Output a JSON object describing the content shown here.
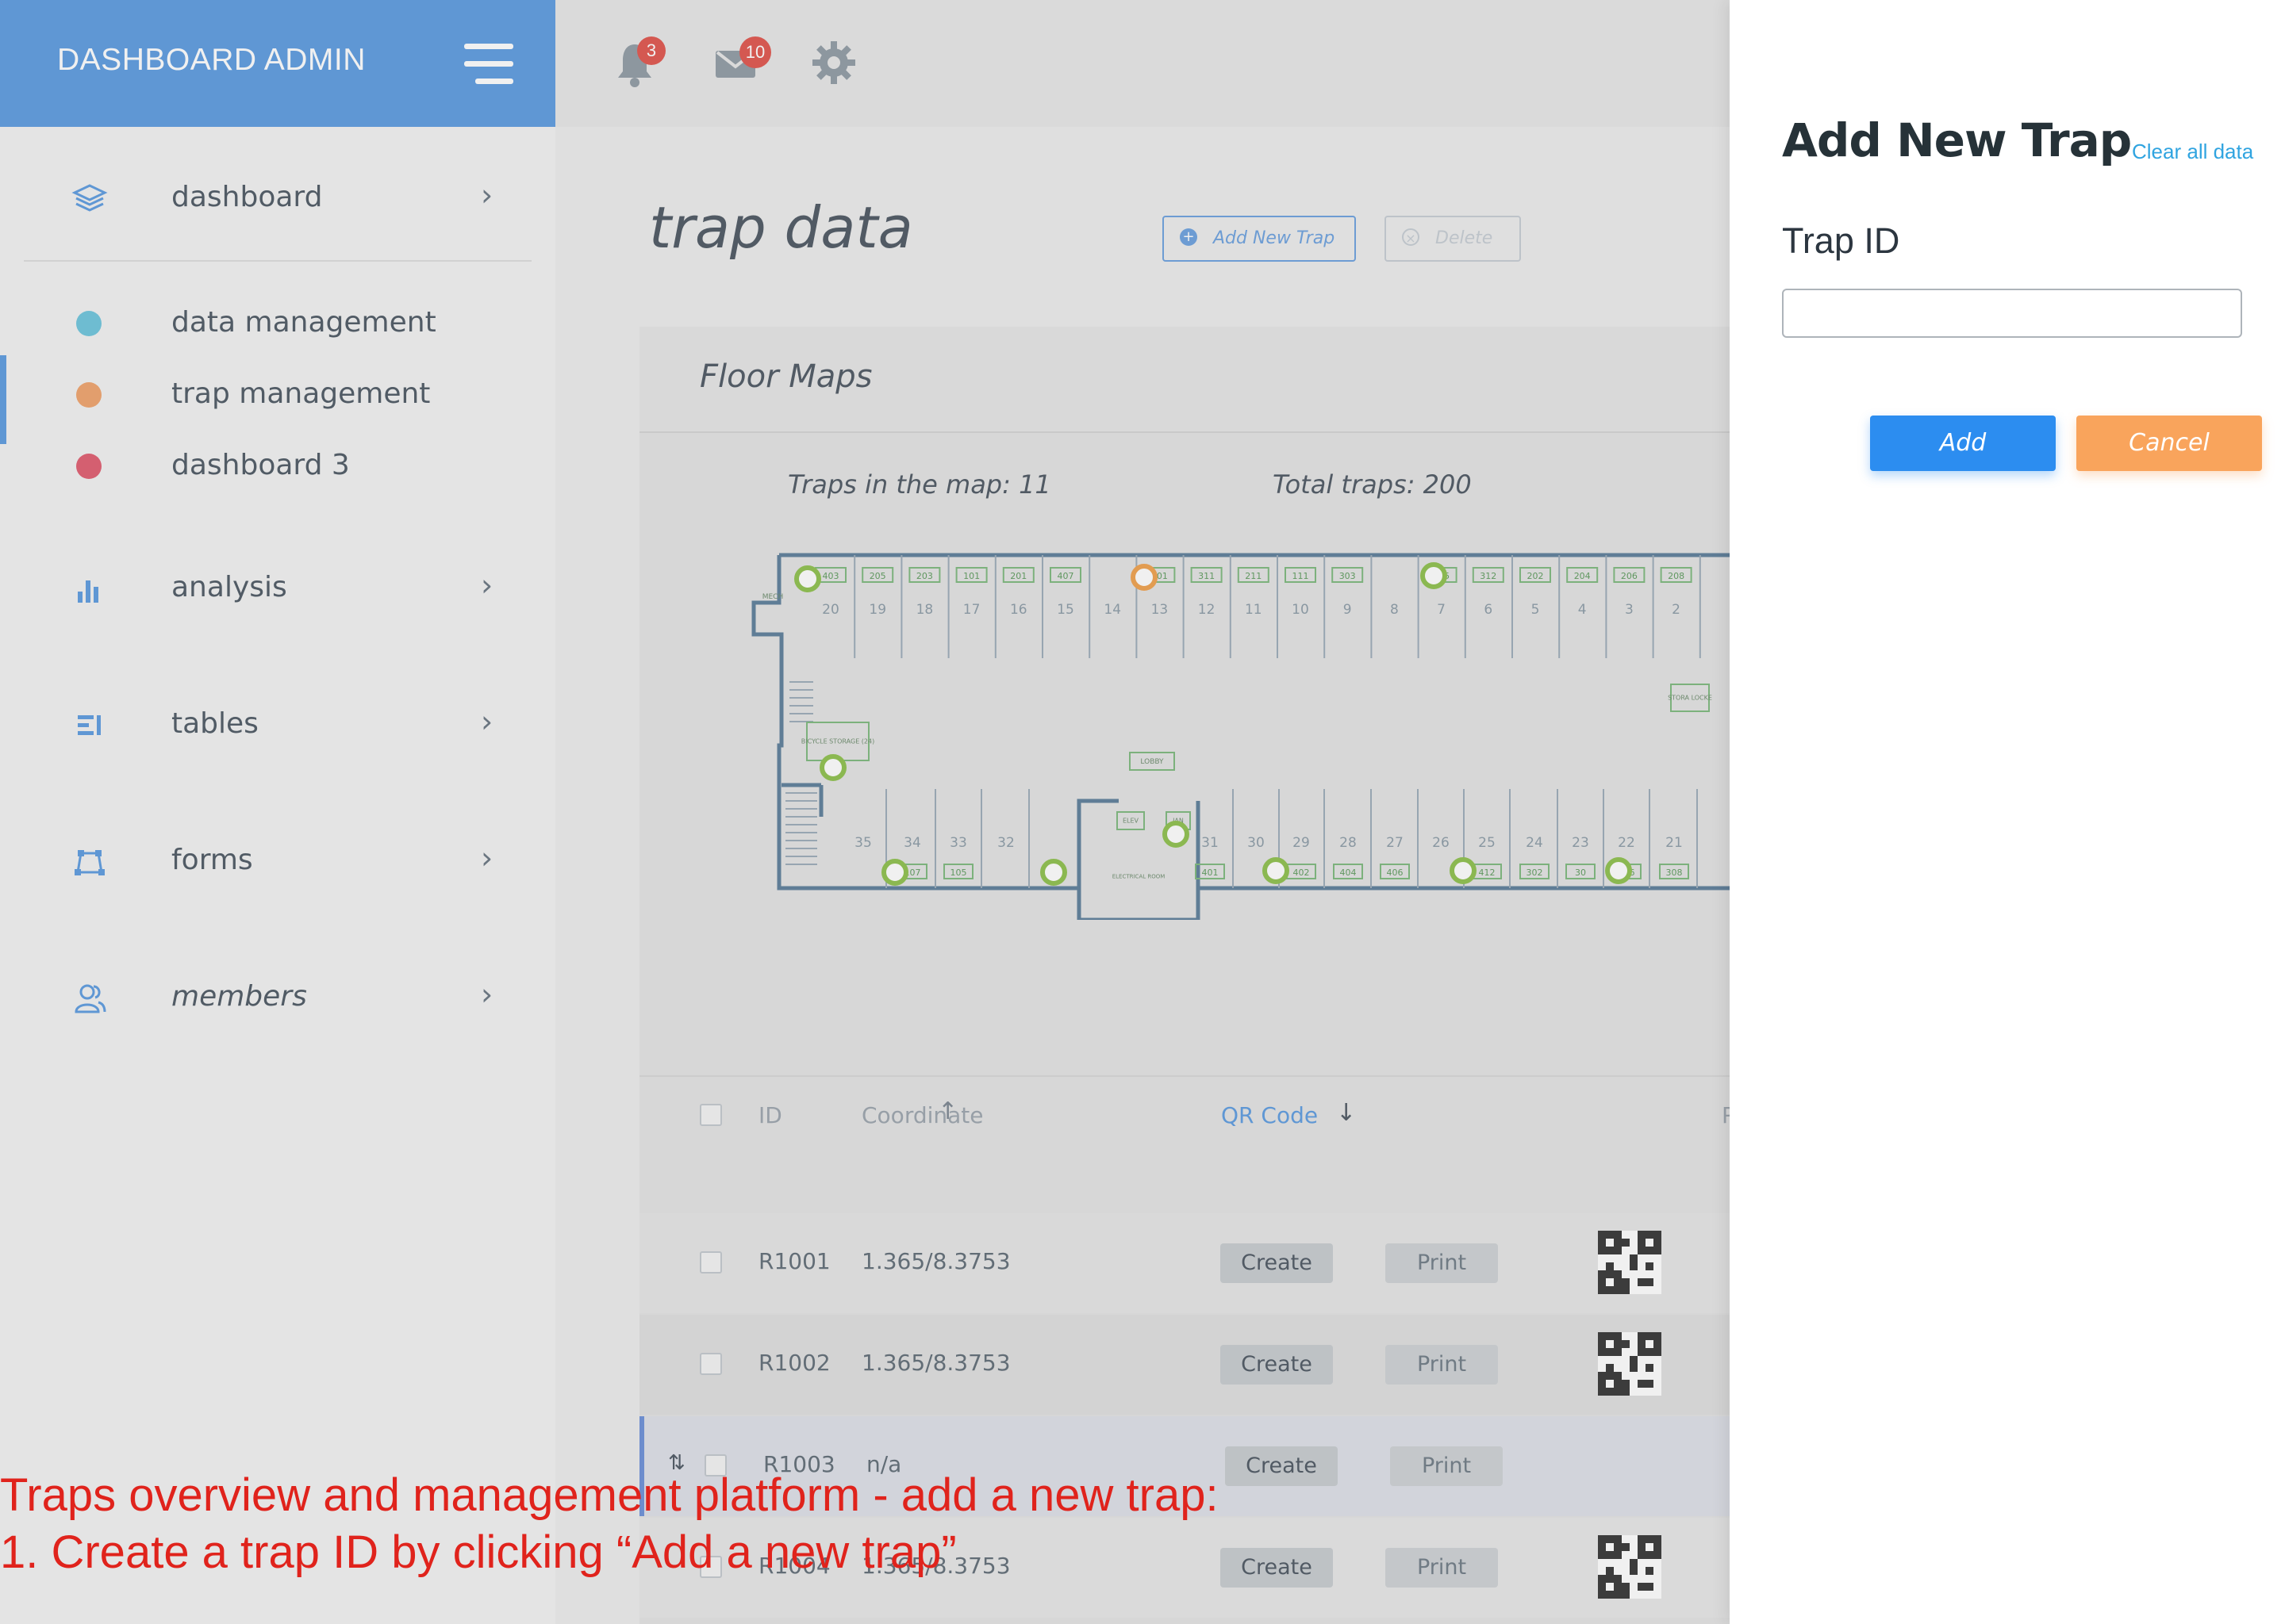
{
  "sidebar": {
    "brand": "DASHBOARD ADMIN",
    "items": [
      {
        "label": "dashboard",
        "icon": "layers-icon"
      },
      {
        "label": "data management",
        "dot_color": "#6cc4dc"
      },
      {
        "label": "trap management",
        "dot_color": "#f0a26a"
      },
      {
        "label": "dashboard 3",
        "dot_color": "#e05a6e"
      },
      {
        "label": "analysis",
        "icon": "bar-chart-icon"
      },
      {
        "label": "tables",
        "icon": "list-icon"
      },
      {
        "label": "forms",
        "icon": "nodes-icon"
      },
      {
        "label": "members",
        "icon": "users-icon"
      }
    ]
  },
  "topbar": {
    "notifications_count": "3",
    "messages_count": "10"
  },
  "page": {
    "title": "trap data",
    "add_button": "Add New Trap",
    "delete_button": "Delete"
  },
  "floor_maps": {
    "title": "Floor Maps",
    "traps_in_map": "Traps in the map: 11",
    "total_traps": "Total traps: 200",
    "top_unit_codes": [
      "403",
      "205",
      "203",
      "101",
      "201",
      "407",
      "",
      "301",
      "311",
      "211",
      "111",
      "303",
      "",
      "305",
      "312",
      "202",
      "204",
      "206",
      "208"
    ],
    "top_numbers": [
      "20",
      "19",
      "18",
      "17",
      "16",
      "15",
      "14",
      "13",
      "12",
      "11",
      "10",
      "9",
      "8",
      "7",
      "6",
      "5",
      "4",
      "3",
      "2"
    ],
    "bottom_numbers": [
      "35",
      "34",
      "33",
      "32",
      "31",
      "30",
      "29",
      "28",
      "27",
      "26",
      "25",
      "24",
      "23",
      "22",
      "21"
    ],
    "bottom_unit_codes": [
      "",
      "107",
      "105",
      "",
      "401",
      "",
      "402",
      "404",
      "406",
      "",
      "412",
      "302",
      "30",
      "306",
      "308"
    ],
    "labels": {
      "mech": "MECH",
      "bicycle": "BICYCLE STORAGE (24)",
      "lobby": "LOBBY",
      "elev": "ELEV",
      "jan": "JAN",
      "electrical": "ELECTRICAL ROOM",
      "storage": "STORA LOCKE"
    }
  },
  "table": {
    "headers": {
      "id": "ID",
      "coordinate": "Coordinate",
      "qr": "QR Code",
      "extra": "P"
    },
    "rows": [
      {
        "id": "R1001",
        "coord": "1.365/8.3753",
        "create": "Create",
        "print": "Print"
      },
      {
        "id": "R1002",
        "coord": "1.365/8.3753",
        "create": "Create",
        "print": "Print"
      },
      {
        "id": "R1003",
        "coord": "n/a",
        "create": "Create",
        "print": "Print"
      },
      {
        "id": "R1004",
        "coord": "1.365/8.3753",
        "create": "Create",
        "print": "Print"
      }
    ]
  },
  "drawer": {
    "title": "Add New Trap",
    "clear": "Clear all data",
    "field_label": "Trap ID",
    "field_value": "",
    "add": "Add",
    "cancel": "Cancel"
  },
  "annotation": {
    "line1": "Traps overview and management platform - add a new trap:",
    "line2": "1. Create a trap ID by clicking “Add a new trap”"
  },
  "colors": {
    "accent": "#5a9ae0",
    "add": "#2c8df0",
    "cancel": "#f9a45c",
    "trap_green": "#8cc04a",
    "trap_orange": "#f0a04a",
    "annotation": "#e0231c"
  }
}
